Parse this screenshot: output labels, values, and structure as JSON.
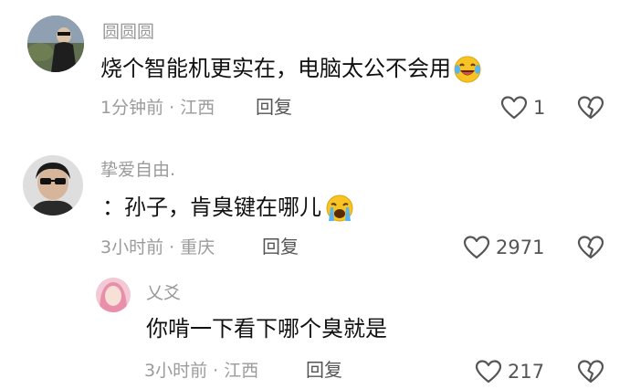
{
  "comments": [
    {
      "username": "圆圆圆",
      "text": "烧个智能机更实在，电脑太公不会用",
      "emoji": "laughing-crying-emoji",
      "time_location": "1分钟前 · 江西",
      "reply_label": "回复",
      "likes": "1"
    },
    {
      "username": "挚爱自由.",
      "text": "：孙子，肯臭键在哪儿",
      "emoji": "crying-emoji",
      "time_location": "3小时前 · 重庆",
      "reply_label": "回复",
      "likes": "2971"
    }
  ],
  "reply": {
    "username": "乂爻",
    "text": "你啃一下看下哪个臭就是",
    "time_location": "3小时前 · 江西",
    "reply_label": "回复",
    "likes": "217"
  },
  "colors": {
    "username": "#9a9a9a",
    "text": "#111111",
    "meta": "#9b9b9b",
    "icon": "#555555",
    "emoji_yellow": "#f7c325"
  }
}
